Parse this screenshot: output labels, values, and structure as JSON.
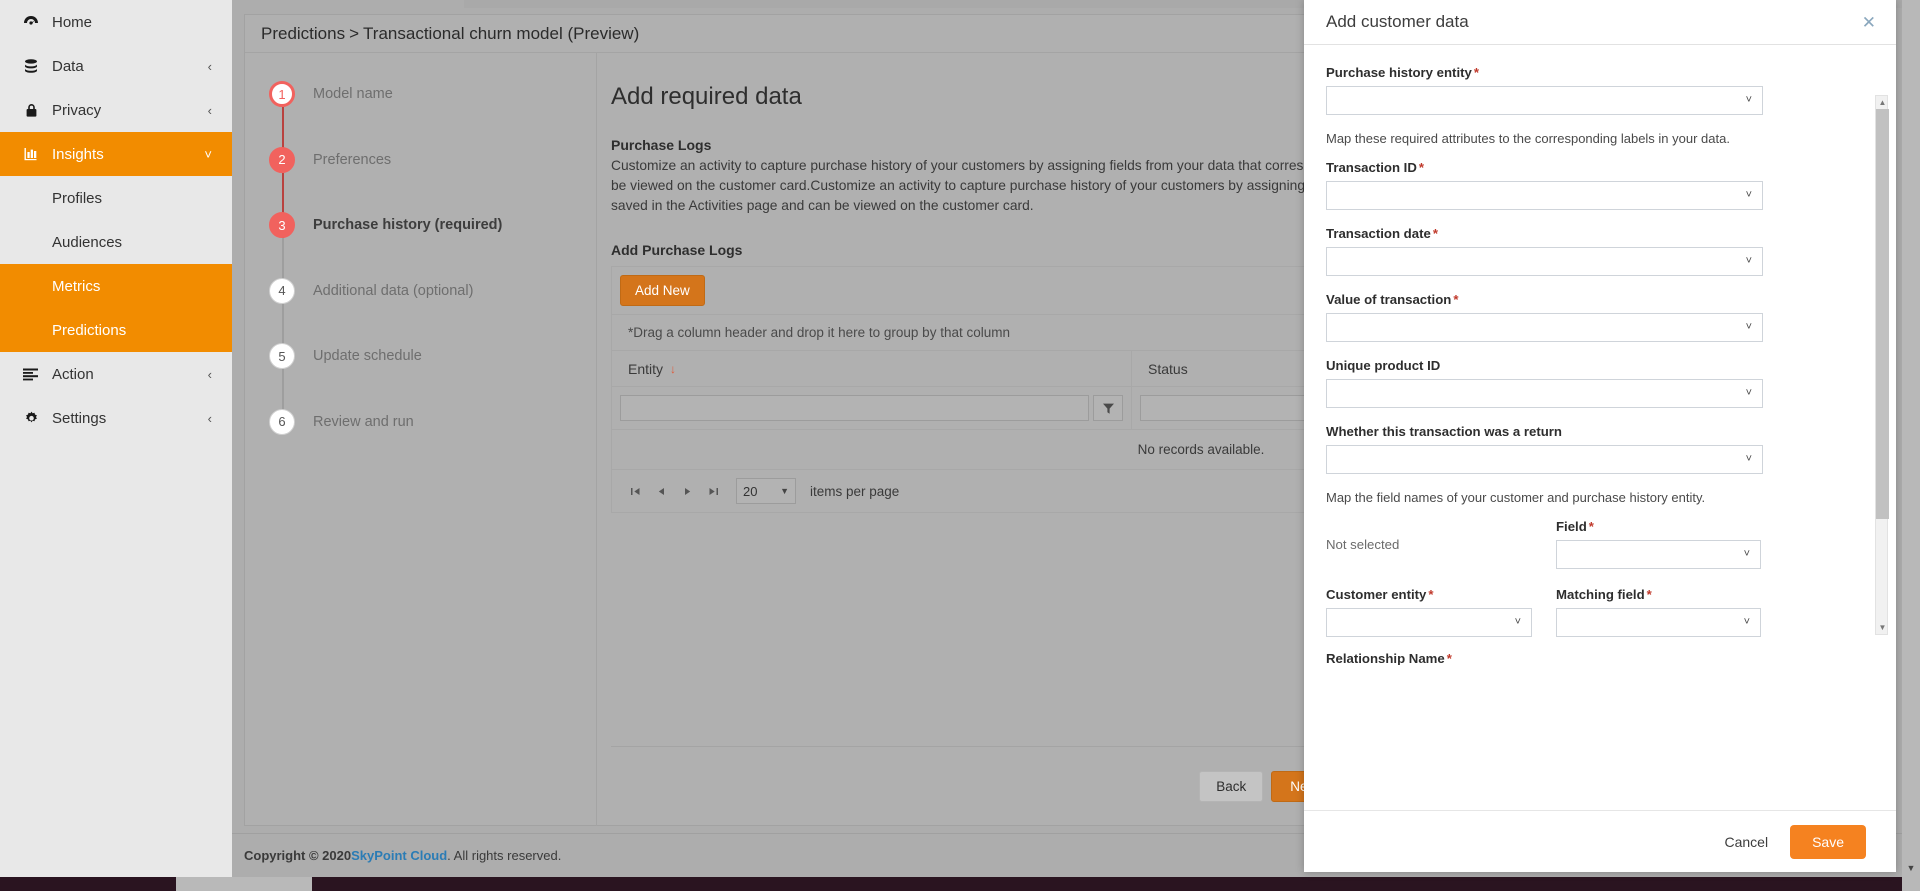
{
  "sidebar": {
    "items": [
      {
        "label": "Home",
        "icon": "dashboard-icon",
        "expandable": false,
        "active": false
      },
      {
        "label": "Data",
        "icon": "database-icon",
        "expandable": true,
        "active": false
      },
      {
        "label": "Privacy",
        "icon": "lock-icon",
        "expandable": true,
        "active": false
      },
      {
        "label": "Insights",
        "icon": "bar-chart-icon",
        "expandable": true,
        "active": true
      },
      {
        "label": "Action",
        "icon": "list-icon",
        "expandable": true,
        "active": false
      },
      {
        "label": "Settings",
        "icon": "gear-icon",
        "expandable": true,
        "active": false
      }
    ],
    "insights_children": [
      {
        "label": "Profiles",
        "active": false
      },
      {
        "label": "Audiences",
        "active": false
      },
      {
        "label": "Metrics",
        "active": true
      },
      {
        "label": "Predictions",
        "active": true
      }
    ]
  },
  "breadcrumb": {
    "root": "Predictions",
    "separator": ">",
    "current": "Transactional churn model (Preview)"
  },
  "stepper": {
    "steps": [
      {
        "number": "1",
        "label": "Model name",
        "state": "ring"
      },
      {
        "number": "2",
        "label": "Preferences",
        "state": "done"
      },
      {
        "number": "3",
        "label": "Purchase history (required)",
        "state": "current"
      },
      {
        "number": "4",
        "label": "Additional data (optional)",
        "state": "pending"
      },
      {
        "number": "5",
        "label": "Update schedule",
        "state": "pending"
      },
      {
        "number": "6",
        "label": "Review and run",
        "state": "pending"
      }
    ]
  },
  "main": {
    "title": "Add required data",
    "section_title": "Purchase Logs",
    "section_text": "Customize an activity to capture purchase history of your customers by assigning fields from your data that correspond to the attributes. The data will also be saved in the Activities page and can be viewed on the customer card.Customize an activity to capture purchase history of your customers by assigning fields from your data that correspond to the attributes. The data will also be saved in the Activities page and can be viewed on the customer card.",
    "subsection_title": "Add Purchase Logs",
    "add_new_label": "Add New",
    "grid": {
      "group_hint": "*Drag a column header and drop it here to group by that column",
      "columns": [
        "Entity",
        "Status"
      ],
      "sort_column": "Entity",
      "sort_direction": "desc",
      "filter_values": [
        "",
        ""
      ],
      "filter_placeholder": "",
      "filter_icon": "funnel-icon",
      "empty_message": "No records available.",
      "rows": [],
      "pager": {
        "first_icon": "first-page-icon",
        "prev_icon": "prev-page-icon",
        "next_icon": "next-page-icon",
        "last_icon": "last-page-icon",
        "page_size": "20",
        "page_size_label": "items per page"
      }
    },
    "back_label": "Back",
    "next_label": "Next"
  },
  "modal": {
    "title": "Add customer data",
    "close_icon": "close-icon",
    "fields": [
      {
        "label": "Purchase history entity",
        "required": true,
        "value": "",
        "width": "full"
      },
      {
        "label": "Transaction ID",
        "required": true,
        "value": "",
        "width": "full"
      },
      {
        "label": "Transaction date",
        "required": true,
        "value": "",
        "width": "full"
      },
      {
        "label": "Value of transaction",
        "required": true,
        "value": "",
        "width": "full"
      },
      {
        "label": "Unique product ID",
        "required": false,
        "value": "",
        "width": "full"
      },
      {
        "label": "Whether this transaction was a return",
        "required": false,
        "value": "",
        "width": "full"
      }
    ],
    "helper_top": "Map these required attributes to the corresponding labels in your data.",
    "helper_mid": "Map the field names of your customer and purchase history entity.",
    "not_selected_text": "Not selected",
    "field_label": "Field",
    "customer_entity_label": "Customer entity",
    "matching_field_label": "Matching field",
    "relationship_name_label": "Relationship Name",
    "cancel_label": "Cancel",
    "save_label": "Save"
  },
  "footer": {
    "copyright_prefix": "Copyright © 2020 ",
    "brand": "SkyPoint Cloud",
    "copyright_suffix": ". All rights reserved."
  },
  "colors": {
    "accent_orange": "#f28c00",
    "button_orange": "#d4751b",
    "save_orange": "#f58220",
    "step_red": "#f1625e",
    "brand_blue": "#2b7cb5"
  }
}
